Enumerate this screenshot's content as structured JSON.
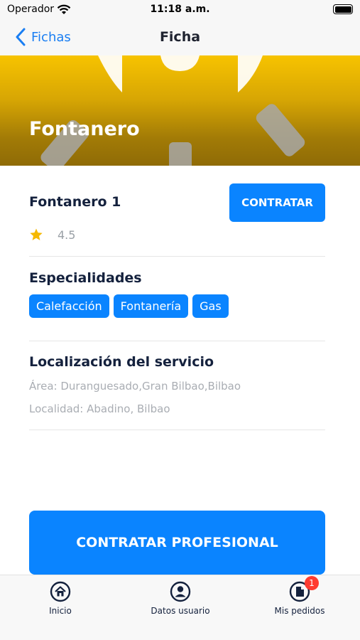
{
  "status_bar": {
    "carrier": "Operador",
    "time": "11:18 a.m."
  },
  "nav": {
    "back_label": "Fichas",
    "title": "Ficha"
  },
  "hero": {
    "title": "Fontanero"
  },
  "provider": {
    "name": "Fontanero 1",
    "rating": "4.5",
    "hire_label": "CONTRATAR"
  },
  "specialties": {
    "title": "Especialidades",
    "items": [
      "Calefacción",
      "Fontanería",
      "Gas"
    ]
  },
  "location": {
    "title": "Localización del servicio",
    "area": "Área: Duranguesado,Gran Bilbao,Bilbao",
    "locality": "Localidad: Abadino, Bilbao"
  },
  "main_button": {
    "label": "CONTRATAR PROFESIONAL"
  },
  "tabs": [
    {
      "label": "Inicio",
      "icon": "home-icon"
    },
    {
      "label": "Datos usuario",
      "icon": "user-icon"
    },
    {
      "label": "Mis pedidos",
      "icon": "document-icon",
      "badge": "1"
    }
  ],
  "colors": {
    "accent": "#0a84ff",
    "hero_top": "#f7c300",
    "hero_bottom": "#8f6b06",
    "badge": "#ff3b30",
    "star": "#f5b800"
  }
}
